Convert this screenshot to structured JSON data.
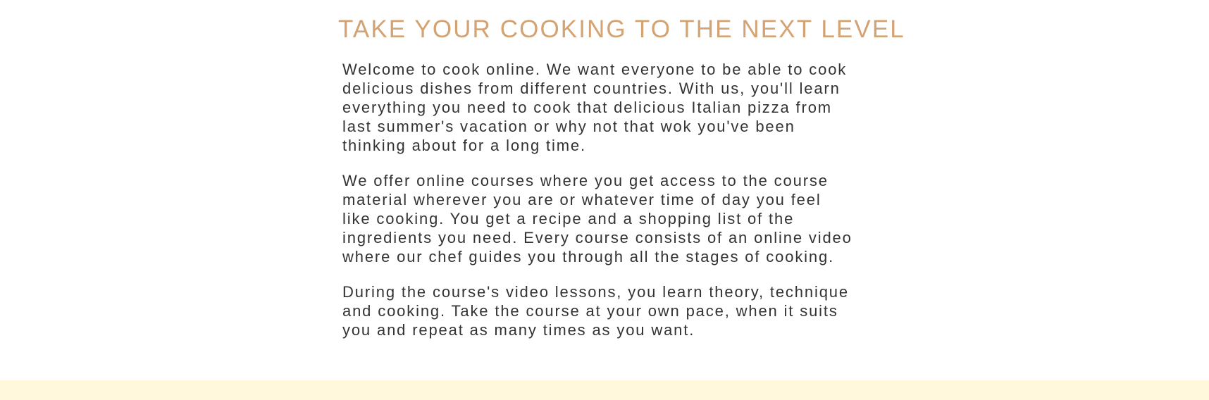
{
  "main": {
    "heading": "TAKE YOUR COOKING TO THE NEXT LEVEL",
    "paragraphs": [
      {
        "lines": [
          "Welcome to cook online. We want everyone to be able to cook",
          "delicious dishes from different countries. With us, you'll learn",
          "everything you need to cook that delicious Italian pizza from",
          "last summer's vacation or why not that wok you've been",
          "thinking about for a long time."
        ]
      },
      {
        "lines": [
          "We offer online courses where you get access to the course",
          "material wherever you are or whatever time of day you feel",
          "like cooking. You get a recipe and a shopping list of the",
          "ingredients you need. Every course consists of an online video",
          "where our chef guides you through all the stages of cooking."
        ]
      },
      {
        "lines": [
          "During the course's video lessons, you learn theory, technique",
          "and cooking. Take the course at your own pace, when it suits",
          "you and repeat as many times as you want."
        ]
      }
    ]
  },
  "colors": {
    "heading": "#d4a373",
    "body_text": "#333333",
    "footer_band": "#fff8dc",
    "background": "#ffffff"
  }
}
